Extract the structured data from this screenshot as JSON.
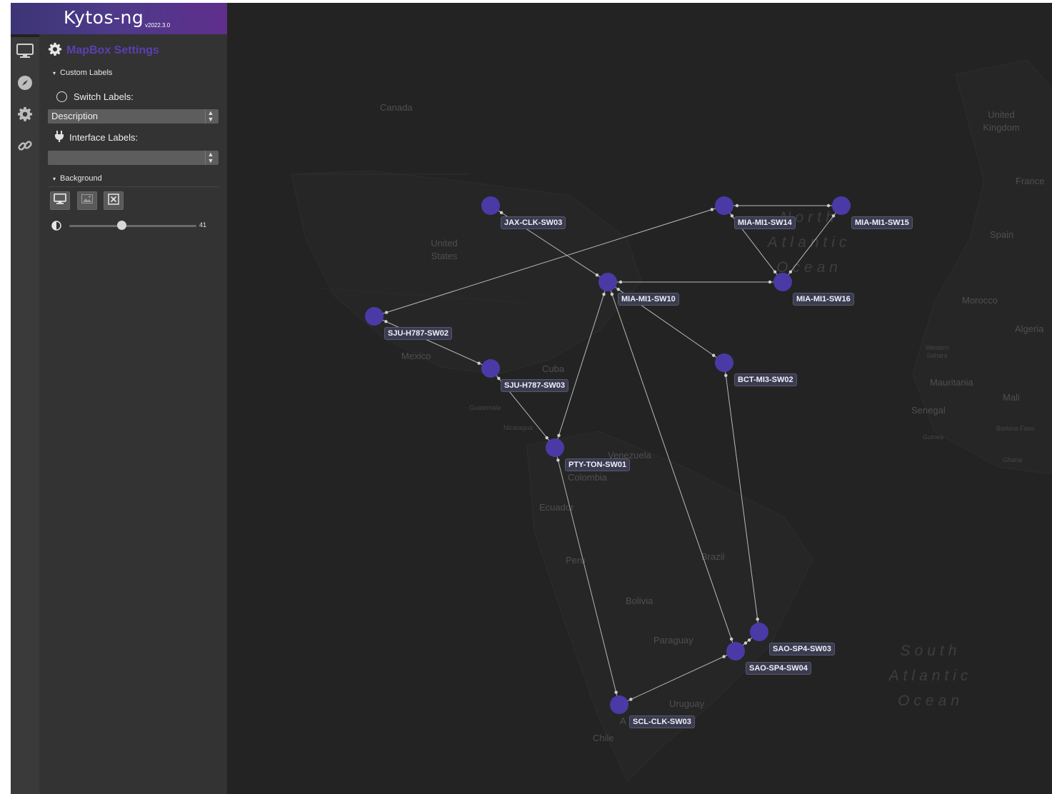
{
  "app": {
    "logo_text": "Kytos-ng",
    "version": "v2022.3.0"
  },
  "sidebar": {
    "icons": [
      "desktop-icon",
      "compass-icon",
      "gear-icon",
      "link-icon"
    ]
  },
  "panel": {
    "title": "MapBox Settings",
    "custom_labels": {
      "heading": "Custom Labels",
      "switch_labels": "Switch Labels:",
      "switch_select_value": "Description",
      "interface_labels": "Interface Labels:",
      "interface_select_value": ""
    },
    "background": {
      "heading": "Background",
      "buttons": [
        "desktop-icon",
        "image-icon",
        "close-box-icon"
      ],
      "opacity_value": "41",
      "opacity_fraction": 0.41
    }
  },
  "map": {
    "geo_labels": {
      "canada": "Canada",
      "united_states": "United States",
      "mexico": "Mexico",
      "cuba": "Cuba",
      "guatemala": "Guatemala",
      "nicaragua": "Nicaragua",
      "venezuela": "Venezuela",
      "colombia": "Colombia",
      "ecuador": "Ecuador",
      "peru": "Peru",
      "brazil": "Brazil",
      "bolivia": "Bolivia",
      "paraguay": "Paraguay",
      "uruguay": "Uruguay",
      "chile": "Chile",
      "argentina_fragment": "A",
      "united_kingdom": "United Kingdom",
      "france": "France",
      "spain": "Spain",
      "morocco": "Morocco",
      "algeria": "Algeria",
      "western_sahara": "Western Sahara",
      "mauritania": "Mauritania",
      "mali": "Mali",
      "senegal": "Senegal",
      "guinea": "Guinea",
      "burkina_faso": "Burkina Faso",
      "ghana": "Ghana",
      "north_atlantic": "North Atlantic Ocean",
      "south_atlantic": "South Atlantic Ocean"
    },
    "switches": [
      "JAX-CLK-SW03",
      "MIA-MI1-SW14",
      "MIA-MI1-SW15",
      "MIA-MI1-SW10",
      "MIA-MI1-SW16",
      "SJU-H787-SW02",
      "SJU-H787-SW03",
      "BCT-MI3-SW02",
      "PTY-TON-SW01",
      "SAO-SP4-SW03",
      "SAO-SP4-SW04",
      "SCL-CLK-SW03"
    ],
    "links": [
      [
        "JAX-CLK-SW03",
        "MIA-MI1-SW10"
      ],
      [
        "MIA-MI1-SW14",
        "MIA-MI1-SW15"
      ],
      [
        "MIA-MI1-SW14",
        "MIA-MI1-SW16"
      ],
      [
        "MIA-MI1-SW15",
        "MIA-MI1-SW16"
      ],
      [
        "MIA-MI1-SW10",
        "MIA-MI1-SW16"
      ],
      [
        "SJU-H787-SW02",
        "MIA-MI1-SW14"
      ],
      [
        "SJU-H787-SW02",
        "SJU-H787-SW03"
      ],
      [
        "SJU-H787-SW03",
        "PTY-TON-SW01"
      ],
      [
        "MIA-MI1-SW10",
        "PTY-TON-SW01"
      ],
      [
        "MIA-MI1-SW10",
        "BCT-MI3-SW02"
      ],
      [
        "MIA-MI1-SW10",
        "SAO-SP4-SW04"
      ],
      [
        "BCT-MI3-SW02",
        "SAO-SP4-SW03"
      ],
      [
        "PTY-TON-SW01",
        "SCL-CLK-SW03"
      ],
      [
        "SAO-SP4-SW03",
        "SAO-SP4-SW04"
      ],
      [
        "SAO-SP4-SW04",
        "SCL-CLK-SW03"
      ]
    ]
  },
  "colors": {
    "accent": "#5a3fb0",
    "node": "#4a3aa6",
    "map_background": "#232323",
    "panel_background": "#333333"
  }
}
